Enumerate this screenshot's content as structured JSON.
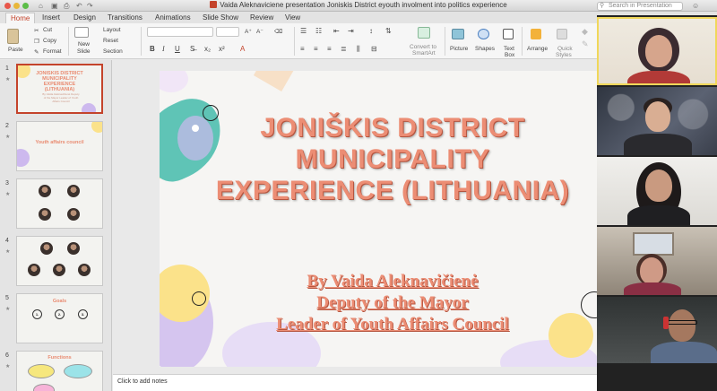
{
  "window": {
    "title": "Vaida Aleknaviciene presentation Joniskis District eyouth involment into politics experience",
    "search_placeholder": "Search in Presentation"
  },
  "tabs": [
    "Home",
    "Insert",
    "Design",
    "Transitions",
    "Animations",
    "Slide Show",
    "Review",
    "View"
  ],
  "active_tab": "Home",
  "ribbon": {
    "paste": "Paste",
    "cut": "Cut",
    "copy": "Copy",
    "format": "Format",
    "new_slide_line1": "New",
    "new_slide_line2": "Slide",
    "layout": "Layout",
    "reset": "Reset",
    "section": "Section",
    "convert_line1": "Convert to",
    "convert_line2": "SmartArt",
    "picture": "Picture",
    "shapes": "Shapes",
    "textbox_line1": "Text",
    "textbox_line2": "Box",
    "arrange": "Arrange",
    "quick_line1": "Quick",
    "quick_line2": "Styles",
    "bold": "B",
    "italic": "I",
    "underline": "U"
  },
  "thumbnails": [
    {
      "num": "1",
      "text": "JONISKIS DISTRICT MUNICIPALITY EXPERIENCE (LITHUANIA)",
      "sub": "By Vaida Aleknavičienė Deputy of the Mayor Leader of Youth Affairs Council",
      "selected": true
    },
    {
      "num": "2",
      "text": "Youth affairs council"
    },
    {
      "num": "3",
      "text": ""
    },
    {
      "num": "4",
      "text": ""
    },
    {
      "num": "5",
      "text": "Goals",
      "steps": [
        "1.",
        "2.",
        "3."
      ]
    },
    {
      "num": "6",
      "text": "Functions"
    }
  ],
  "slide": {
    "title_lines": [
      "JONIŠKIS DISTRICT",
      "MUNICIPALITY",
      "EXPERIENCE (LITHUANIA)"
    ],
    "subtitle_lines": [
      "By Vaida Aleknavičienė",
      "Deputy of the Mayor",
      "Leader of Youth Affairs Council"
    ]
  },
  "notes_placeholder": "Click to add notes",
  "colors": {
    "accent": "#c4432b",
    "title": "#ec8d74",
    "teal": "#5fc4b6",
    "yellow": "#fbe28a",
    "lavender": "#cdb9ee"
  }
}
